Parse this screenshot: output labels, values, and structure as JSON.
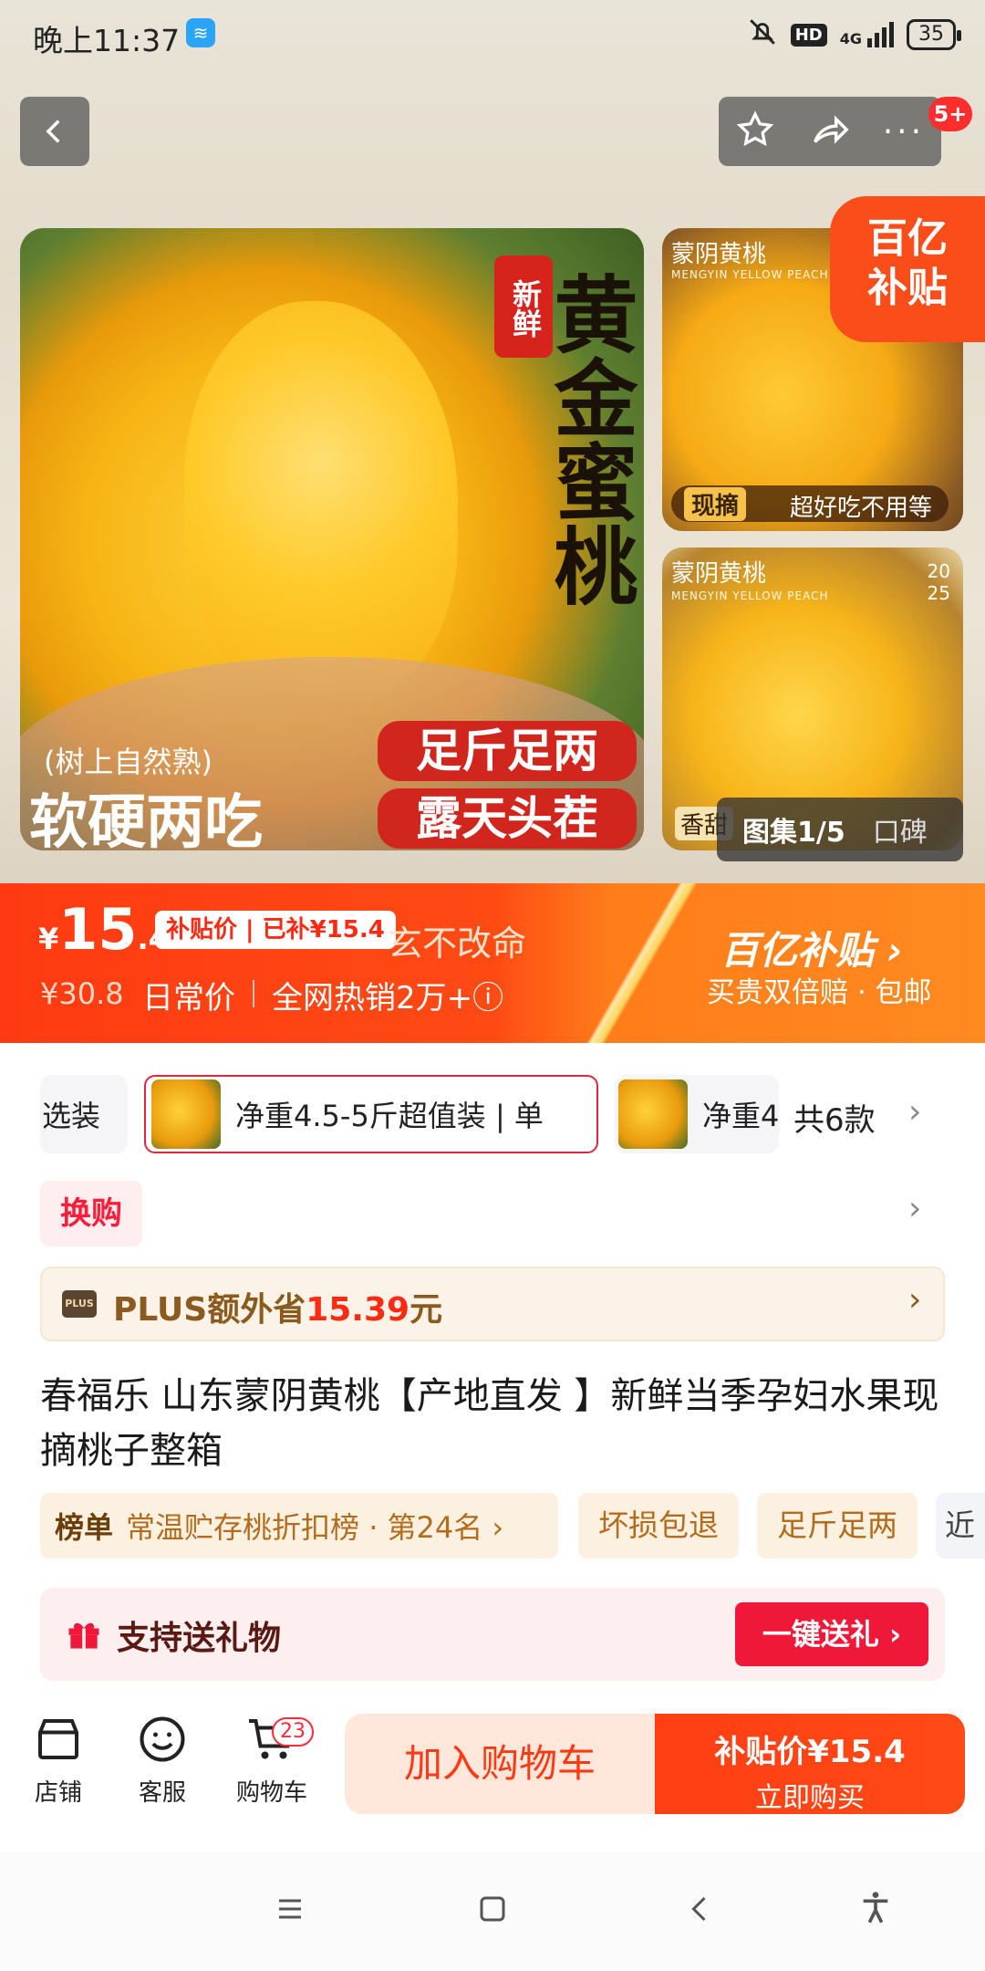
{
  "status_bar": {
    "time": "晚上11:37",
    "hd": "HD",
    "network": "4G",
    "battery": "35"
  },
  "top_actions": {
    "back_label": "‹",
    "badge": "5+"
  },
  "gallery": {
    "main_image": {
      "vertical_title": "黄金蜜桃",
      "seal": "新鲜",
      "tagline_small": "(树上自然熟)",
      "tagline_big": "软硬两吃",
      "tag1": "足斤足两",
      "tag2": "露天头茬"
    },
    "side1": {
      "title": "蒙阴黄桃",
      "subtitle": "MENGYIN YELLOW PEACH",
      "badge": "现摘",
      "caption": "超好吃不用等"
    },
    "side2": {
      "title": "蒙阴黄桃",
      "subtitle": "MENGYIN YELLOW PEACH",
      "year": "20\n25",
      "caption_left": "香甜",
      "caption_right": "口碑"
    },
    "subsidy_corner": "百亿\n补贴",
    "counter": "图集1/5"
  },
  "price_banner": {
    "currency": "¥",
    "price_int": "15",
    "price_dec": ".4",
    "subsidy_tag": "补贴价 | 已补¥15.4",
    "tagline": "玄不改命",
    "old_price": "¥30.8",
    "daily_label": "日常价",
    "hot_sales": "全网热销2万+ⓘ",
    "brand": "百亿补贴 ›",
    "brand_sub": "买贵双倍赔 · 包邮"
  },
  "options": {
    "left_label": "选装",
    "selected": "净重4.5-5斤超值装 | 单",
    "next": "净重4",
    "count": "共6款"
  },
  "exchange": {
    "label": "换购"
  },
  "plus": {
    "icon": "PLUS",
    "text_prefix": "PLUS额外省",
    "amount": "15.39",
    "text_suffix": "元"
  },
  "product": {
    "title": "春福乐 山东蒙阴黄桃【产地直发 】新鲜当季孕妇水果现摘桃子整箱"
  },
  "rank": {
    "label": "榜单",
    "text": "常温贮存桃折扣榜 · 第24名 ›"
  },
  "tags": [
    "坏损包退",
    "足斤足两",
    "近"
  ],
  "gift": {
    "label": "支持送礼物",
    "button": "一键送礼 ›"
  },
  "bottom_nav": {
    "store": "店铺",
    "service": "客服",
    "cart": "购物车",
    "cart_count": "23",
    "add_to_cart": "加入购物车",
    "buy_price": "补贴价¥15.4",
    "buy_now": "立即购买"
  },
  "colors": {
    "accent": "#ff3a12",
    "gift_red": "#f01838",
    "plus_brown": "#8b5a1e"
  }
}
